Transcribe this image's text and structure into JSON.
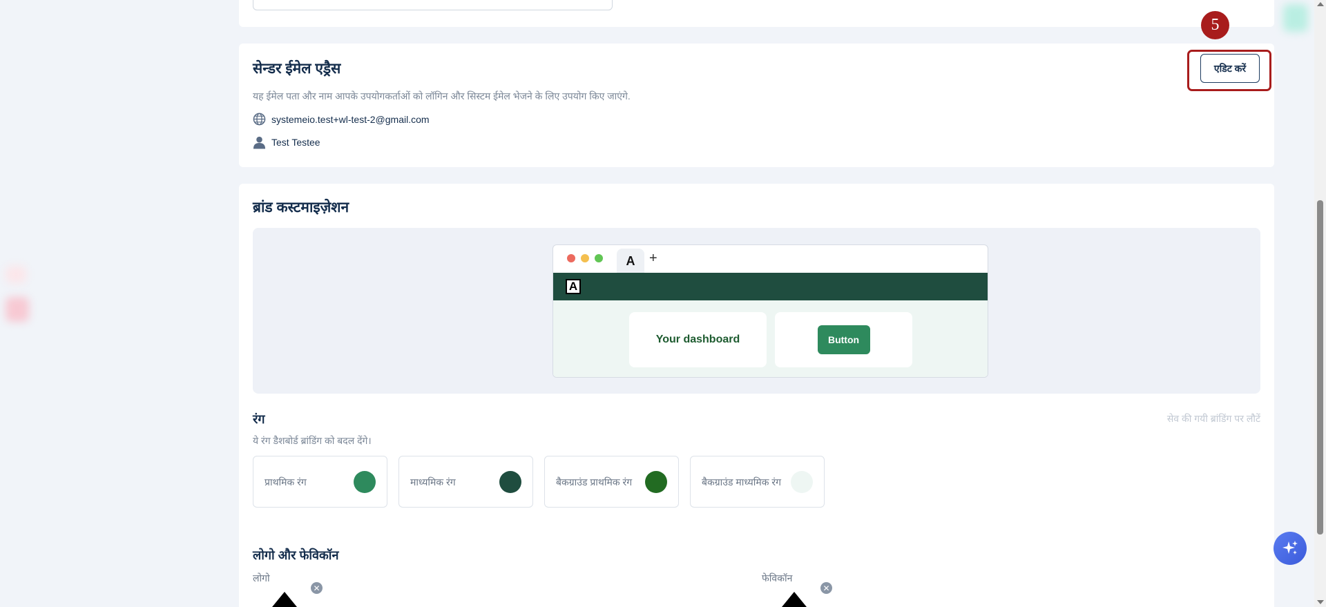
{
  "sender_section": {
    "title": "सेन्डर ईमेल एड्रैस",
    "description": "यह ईमेल पता और नाम आपके उपयोगकर्ताओं को लॉगिन और सिस्टम ईमेल भेजने के लिए उपयोग किए जाएंगे.",
    "email": "systemeio.test+wl-test-2@gmail.com",
    "name": "Test Testee",
    "edit_label": "एडिट करें",
    "step_number": "5"
  },
  "brand_section": {
    "title": "ब्रांड कस्टमाइज़ेशन",
    "preview": {
      "tab_letter": "A",
      "plus": "+",
      "logo_letter": "A",
      "dashboard_label": "Your dashboard",
      "button_label": "Button",
      "header_color": "#1f4d3f",
      "button_color": "#2e8a5d"
    },
    "colors": {
      "title": "रंग",
      "description": "ये रंग डैशबोर्ड ब्रांडिंग को बदल देंगे।",
      "reset_label": "सेव की गयी ब्रांडिंग पर लौटें",
      "items": [
        {
          "label": "प्राथमिक रंग",
          "color": "#2e8a5d"
        },
        {
          "label": "माध्यमिक रंग",
          "color": "#1f4d3f"
        },
        {
          "label": "बैकग्राउंड प्राथमिक रंग",
          "color": "#226b22"
        },
        {
          "label": "बैकग्राउंड माध्यमिक रंग",
          "color": "#eef6f3"
        }
      ]
    },
    "logos": {
      "title": "लोगो और फेविकॉन",
      "logo_label": "लोगो",
      "favicon_label": "फेविकॉन"
    }
  },
  "icons": {
    "globe": "globe-icon",
    "user": "user-icon",
    "remove": "close-circle-icon",
    "sparkle": "sparkle-icon"
  }
}
